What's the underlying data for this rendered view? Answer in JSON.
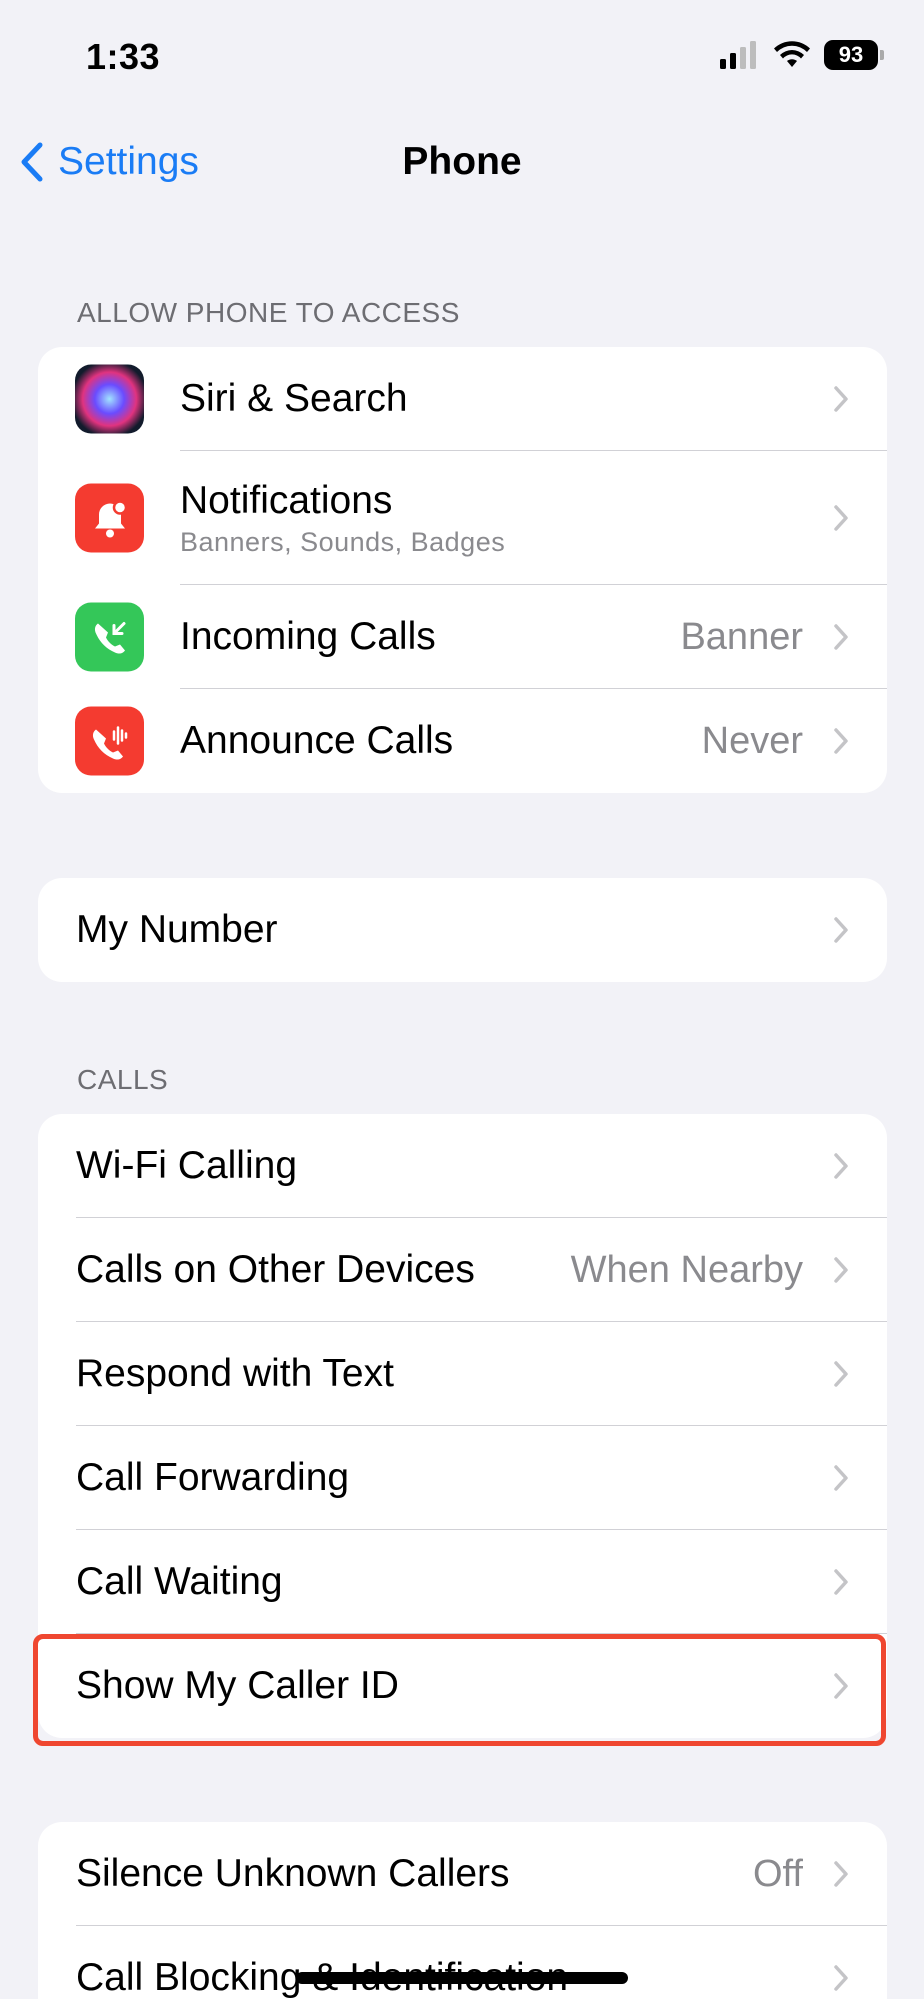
{
  "status_bar": {
    "time": "1:33",
    "battery": "93"
  },
  "nav": {
    "back_label": "Settings",
    "title": "Phone"
  },
  "sections": {
    "access_header": "ALLOW PHONE TO ACCESS",
    "calls_header": "CALLS"
  },
  "access_rows": [
    {
      "label": "Siri & Search"
    },
    {
      "label": "Notifications",
      "sublabel": "Banners, Sounds, Badges"
    },
    {
      "label": "Incoming Calls",
      "value": "Banner"
    },
    {
      "label": "Announce Calls",
      "value": "Never"
    }
  ],
  "my_number": {
    "label": "My Number"
  },
  "calls_rows": [
    {
      "label": "Wi-Fi Calling"
    },
    {
      "label": "Calls on Other Devices",
      "value": "When Nearby"
    },
    {
      "label": "Respond with Text"
    },
    {
      "label": "Call Forwarding"
    },
    {
      "label": "Call Waiting"
    },
    {
      "label": "Show My Caller ID"
    }
  ],
  "silence_rows": [
    {
      "label": "Silence Unknown Callers",
      "value": "Off"
    },
    {
      "label": "Call Blocking & Identification"
    }
  ],
  "colors": {
    "accent": "#1a7cf5",
    "highlight": "#ef4730",
    "background": "#f2f2f7"
  }
}
